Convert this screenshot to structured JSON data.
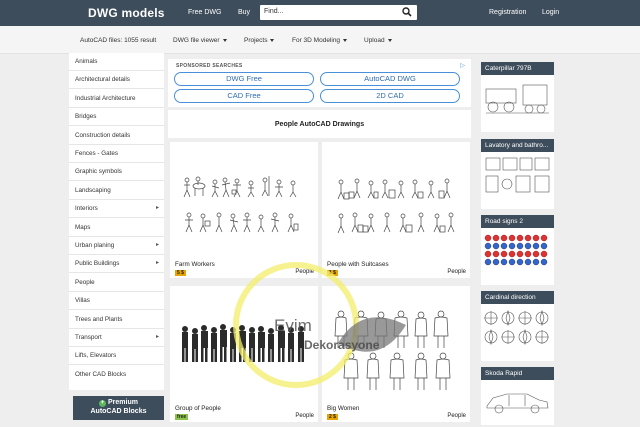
{
  "header": {
    "logo": "DWG models",
    "links": {
      "free_dwg": "Free DWG",
      "buy": "Buy",
      "registration": "Registration",
      "login": "Login"
    },
    "search": {
      "value": "Find..."
    }
  },
  "subnav": {
    "files_count": "AutoCAD files: 1055 result",
    "menus": [
      "DWG file viewer",
      "Projects",
      "For 3D Modeling",
      "Upload"
    ]
  },
  "sidebar": {
    "items": [
      {
        "label": "Animals",
        "arrow": false
      },
      {
        "label": "Architectural details",
        "arrow": false
      },
      {
        "label": "Industrial Architecture",
        "arrow": false
      },
      {
        "label": "Bridges",
        "arrow": false
      },
      {
        "label": "Construction details",
        "arrow": false
      },
      {
        "label": "Fences - Gates",
        "arrow": false
      },
      {
        "label": "Graphic symbols",
        "arrow": false
      },
      {
        "label": "Landscaping",
        "arrow": false
      },
      {
        "label": "Interiors",
        "arrow": true
      },
      {
        "label": "Maps",
        "arrow": false
      },
      {
        "label": "Urban planing",
        "arrow": true
      },
      {
        "label": "Public Buildings",
        "arrow": true
      },
      {
        "label": "People",
        "arrow": false
      },
      {
        "label": "Villas",
        "arrow": false
      },
      {
        "label": "Trees and Plants",
        "arrow": false
      },
      {
        "label": "Transport",
        "arrow": true
      },
      {
        "label": "Lifts, Elevators",
        "arrow": false
      },
      {
        "label": "Other CAD Blocks",
        "arrow": false
      }
    ],
    "arrow_glyph": "▸",
    "premium": {
      "line1": "Premium",
      "line2": "AutoCAD Blocks"
    }
  },
  "sponsored": {
    "title": "SPONSORED SEARCHES",
    "buttons": [
      "DWG Free",
      "AutoCAD DWG",
      "CAD Free",
      "2D CAD"
    ]
  },
  "main": {
    "heading": "People AutoCAD Drawings",
    "cards": [
      {
        "name": "Farm Workers",
        "badge": "5 $",
        "badge_color": "#e8a400",
        "category": "People"
      },
      {
        "name": "People with Suitcases",
        "badge": "1 $",
        "badge_color": "#e8a400",
        "category": "People"
      },
      {
        "name": "Group of People",
        "badge": "free",
        "badge_color": "#8bc34a",
        "category": "People"
      },
      {
        "name": "Big Women",
        "badge": "2 $",
        "badge_color": "#e8a400",
        "category": "People"
      }
    ]
  },
  "right": {
    "items": [
      "Caterpillar 797B",
      "Lavatory and bathro...",
      "Road signs 2",
      "Cardinal direction",
      "Skoda Rapid"
    ]
  },
  "watermark": {
    "text1": "Evim",
    "text2": "Dekorasyone"
  },
  "colors": {
    "header_bg": "#3d4d5b",
    "accent_blue": "#4a90d9",
    "badge_gold": "#e8a400",
    "badge_green": "#8bc34a"
  }
}
